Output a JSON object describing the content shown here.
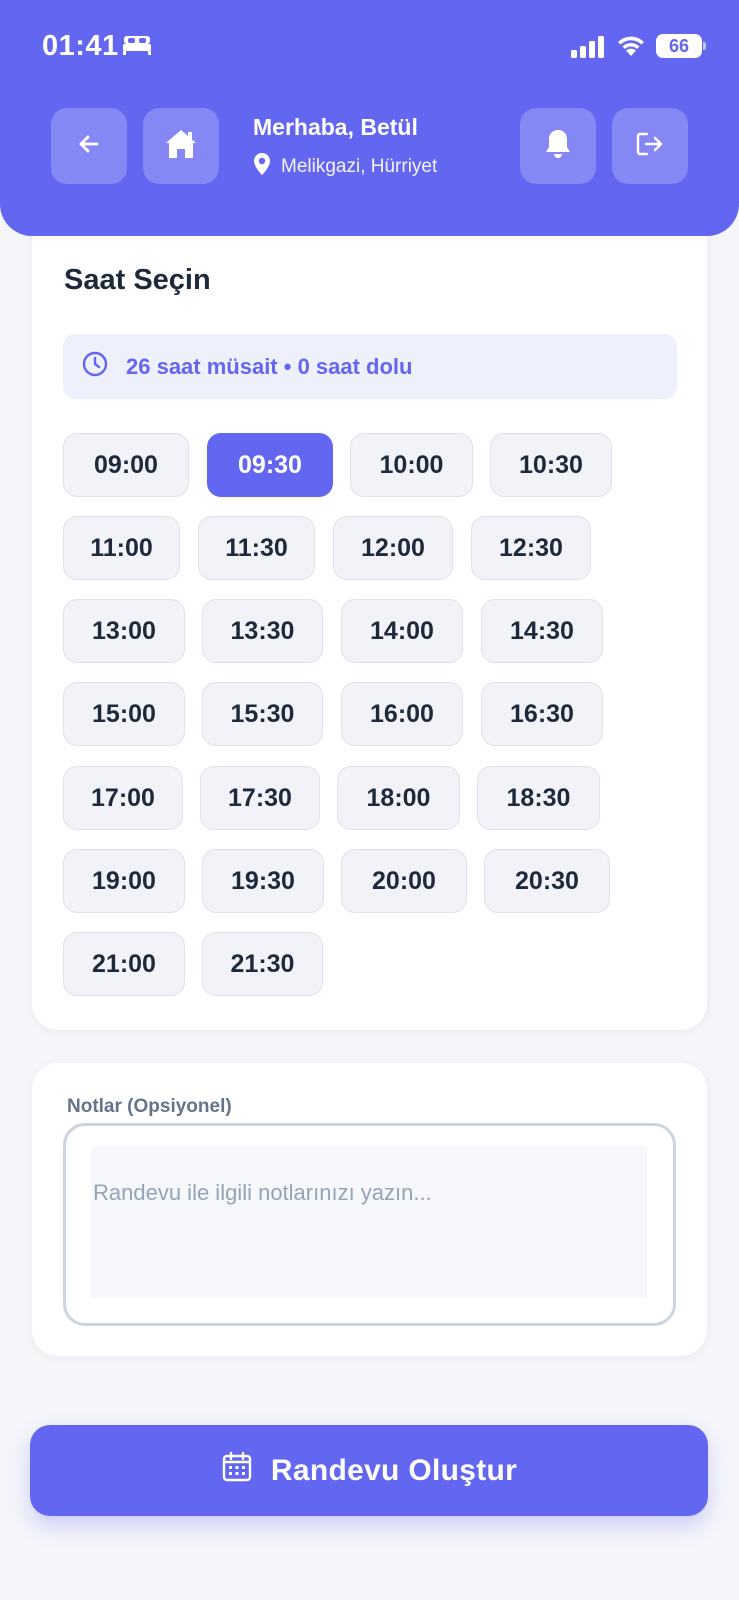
{
  "status_bar": {
    "time": "01:41",
    "battery": "66",
    "icons": [
      "sleep-focus-icon",
      "cellular-signal-icon",
      "wifi-icon",
      "battery-icon"
    ]
  },
  "header": {
    "greeting": "Merhaba, Betül",
    "location": "Melikgazi, Hürriyet",
    "icons": [
      "back-arrow-icon",
      "home-icon",
      "location-pin-icon",
      "bell-icon",
      "logout-icon"
    ],
    "background": "#6366f1"
  },
  "time_section": {
    "title": "Saat Seçin",
    "availability": "26 saat müsait • 0 saat dolu",
    "selected": "09:30",
    "slots": [
      "09:00",
      "09:30",
      "10:00",
      "10:30",
      "11:00",
      "11:30",
      "12:00",
      "12:30",
      "13:00",
      "13:30",
      "14:00",
      "14:30",
      "15:00",
      "15:30",
      "16:00",
      "16:30",
      "17:00",
      "17:30",
      "18:00",
      "18:30",
      "19:00",
      "19:30",
      "20:00",
      "20:30",
      "21:00",
      "21:30"
    ]
  },
  "notes": {
    "label": "Notlar (Opsiyonel)",
    "value": "",
    "placeholder": "Randevu ile ilgili notlarınızı yazın..."
  },
  "submit": {
    "label": "Randevu Oluştur",
    "icon": "calendar-icon"
  },
  "colors": {
    "accent": "#6366f1",
    "slot_bg": "#f1f3f8",
    "text": "#1e293b"
  }
}
